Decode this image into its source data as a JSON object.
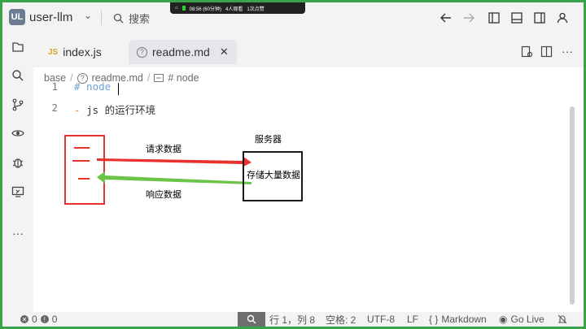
{
  "titlebar": {
    "project_badge": "UL",
    "project_name": "user-llm",
    "search_label": "搜索",
    "overlay_time": "08:56 (60分钟)",
    "overlay_viewers": "4人观看",
    "overlay_likes": "1次点赞"
  },
  "tabs": [
    {
      "icon": "JS",
      "label": "index.js"
    },
    {
      "icon": "?",
      "label": "readme.md",
      "close": "✕"
    }
  ],
  "breadcrumb": {
    "root": "base",
    "file": "readme.md",
    "section": "# node"
  },
  "code": {
    "line1_num": "1",
    "line1_text": "# node",
    "line2_num": "2",
    "line2_dash": "-",
    "line2_text": "js 的运行环境"
  },
  "diagram": {
    "request_label": "请求数据",
    "response_label": "响应数据",
    "server_title": "服务器",
    "server_content": "存储大量数据",
    "client_color": "#e8302d",
    "request_color": "#e8302d",
    "response_color": "#6cc34a"
  },
  "status": {
    "errors": "0",
    "warnings": "0",
    "position": "行 1，列 8",
    "spaces": "空格: 2",
    "encoding": "UTF-8",
    "eol": "LF",
    "language": "Markdown",
    "golive": "Go Live"
  }
}
